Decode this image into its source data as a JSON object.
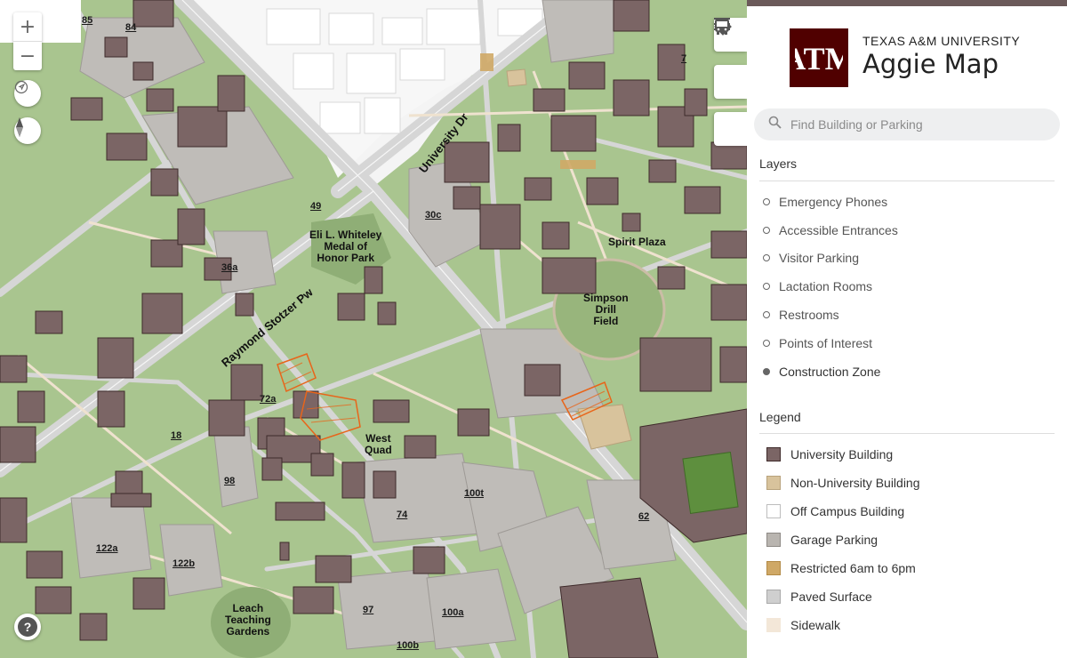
{
  "map": {
    "building_labels": [
      {
        "id": "85",
        "text": "85"
      },
      {
        "id": "84",
        "text": "84"
      },
      {
        "id": "7",
        "text": "7"
      },
      {
        "id": "49",
        "text": "49"
      },
      {
        "id": "30c",
        "text": "30c"
      },
      {
        "id": "36a",
        "text": "36a"
      },
      {
        "id": "72a",
        "text": "72a"
      },
      {
        "id": "18",
        "text": "18"
      },
      {
        "id": "98",
        "text": "98"
      },
      {
        "id": "74",
        "text": "74"
      },
      {
        "id": "100t",
        "text": "100t"
      },
      {
        "id": "62",
        "text": "62"
      },
      {
        "id": "122a",
        "text": "122a"
      },
      {
        "id": "122b",
        "text": "122b"
      },
      {
        "id": "97",
        "text": "97"
      },
      {
        "id": "100a",
        "text": "100a"
      },
      {
        "id": "100b",
        "text": "100b"
      }
    ],
    "places": {
      "whiteley": "Eli L. Whiteley\nMedal of\nHonor Park",
      "spirit_plaza": "Spirit Plaza",
      "simpson": "Simpson\nDrill\nField",
      "west_quad": "West\nQuad",
      "leach": "Leach\nTeaching\nGardens"
    },
    "roads": {
      "university_dr": "University Dr",
      "stotzer": "Raymond Stotzer Pw"
    },
    "controls": {
      "zoom_in": "+",
      "zoom_out": "−",
      "help": "?"
    },
    "icons": [
      "locate-icon",
      "compass-icon",
      "menu-icon",
      "directions-icon",
      "bus-icon",
      "help-icon",
      "search-icon"
    ]
  },
  "panel": {
    "university": "TEXAS A&M UNIVERSITY",
    "app_title": "Aggie Map",
    "logo_text": "ATM",
    "search_placeholder": "Find Building or Parking",
    "layers_heading": "Layers",
    "layers": [
      {
        "label": "Emergency Phones",
        "active": false
      },
      {
        "label": "Accessible Entrances",
        "active": false
      },
      {
        "label": "Visitor Parking",
        "active": false
      },
      {
        "label": "Lactation Rooms",
        "active": false
      },
      {
        "label": "Restrooms",
        "active": false
      },
      {
        "label": "Points of Interest",
        "active": false
      },
      {
        "label": "Construction Zone",
        "active": true
      }
    ],
    "legend_heading": "Legend",
    "legend": [
      {
        "label": "University Building",
        "color": "#7b6565",
        "border": "#3e2a2a"
      },
      {
        "label": "Non-University Building",
        "color": "#d8c39c",
        "border": "#b8a27c"
      },
      {
        "label": "Off Campus Building",
        "color": "#ffffff",
        "border": "#bdbdbd"
      },
      {
        "label": "Garage Parking",
        "color": "#b9b5b0",
        "border": "#8e8a86"
      },
      {
        "label": "Restricted 6am to 6pm",
        "color": "#cfa866",
        "border": "#b38a46"
      },
      {
        "label": "Paved Surface",
        "color": "#cfcfcf",
        "border": "#a9a9a9"
      },
      {
        "label": "Sidewalk",
        "color": "#f3e7d8",
        "border": "#f3e7d8"
      }
    ]
  },
  "colors": {
    "maroon": "#500000",
    "building": "#7b6565",
    "grass": "#a9c58f",
    "road": "#d3d3d3"
  }
}
